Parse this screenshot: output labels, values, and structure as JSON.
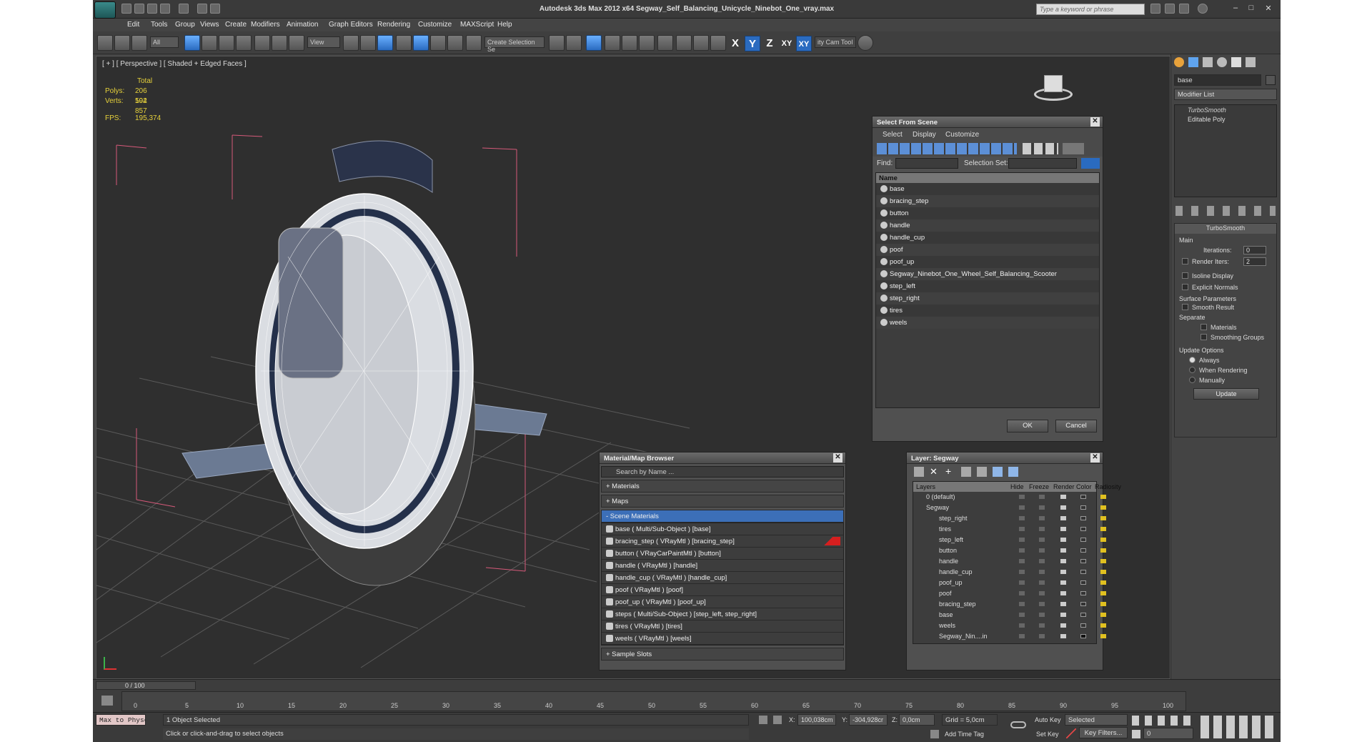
{
  "app": {
    "title": "Autodesk 3ds Max  2012 x64      Segway_Self_Balancing_Unicycle_Ninebot_One_vray.max",
    "search_placeholder": "Type a keyword or phrase"
  },
  "menu": [
    "Edit",
    "Tools",
    "Group",
    "Views",
    "Create",
    "Modifiers",
    "Animation",
    "Graph Editors",
    "Rendering",
    "Customize",
    "MAXScript",
    "Help"
  ],
  "toolbar": {
    "filter_value": "All",
    "view_value": "View",
    "selection_set_placeholder": "Create Selection Se",
    "axes": [
      "X",
      "Y",
      "Z",
      "XY",
      "XY"
    ],
    "cam_tool": "ity Cam Tool"
  },
  "viewport": {
    "label": "[ + ] [ Perspective ] [ Shaded + Edged Faces ]",
    "stats_header": "Total",
    "polys_label": "Polys:",
    "polys_value": "206 592",
    "verts_label": "Verts:",
    "verts_value": "104 857",
    "fps_label": "FPS:",
    "fps_value": "195,374"
  },
  "select_from_scene": {
    "title": "Select From Scene",
    "menu": [
      "Select",
      "Display",
      "Customize"
    ],
    "find_label": "Find:",
    "selection_set_label": "Selection Set:",
    "column_name": "Name",
    "items": [
      "base",
      "bracing_step",
      "button",
      "handle",
      "handle_cup",
      "poof",
      "poof_up",
      "Segway_Ninebot_One_Wheel_Self_Balancing_Scooter",
      "step_left",
      "step_right",
      "tires",
      "weels"
    ],
    "ok": "OK",
    "cancel": "Cancel"
  },
  "material_browser": {
    "title": "Material/Map Browser",
    "search_placeholder": "Search by Name ...",
    "sections": [
      "+ Materials",
      "+ Maps"
    ],
    "scene_materials_header": "- Scene Materials",
    "items": [
      "base  ( Multi/Sub-Object )  [base]",
      "bracing_step  ( VRayMtl )  [bracing_step]",
      "button  ( VRayCarPaintMtl )  [button]",
      "handle  ( VRayMtl )  [handle]",
      "handle_cup  ( VRayMtl )  [handle_cup]",
      "poof  ( VRayMtl )  [poof]",
      "poof_up  ( VRayMtl )  [poof_up]",
      "steps  ( Multi/Sub-Object )  [step_left, step_right]",
      "tires  ( VRayMtl )  [tires]",
      "weels  ( VRayMtl )  [weels]"
    ],
    "sample_slots": "+ Sample Slots"
  },
  "layers": {
    "title": "Layer: Segway",
    "columns": [
      "Layers",
      "Hide",
      "Freeze",
      "Render",
      "Color",
      "Radiosity"
    ],
    "rows": [
      "0 (default)",
      "Segway",
      "step_right",
      "tires",
      "step_left",
      "button",
      "handle",
      "handle_cup",
      "poof_up",
      "poof",
      "bracing_step",
      "base",
      "weels",
      "Segway_Nin....in"
    ]
  },
  "command_panel": {
    "name_value": "base",
    "modifier_list": "Modifier List",
    "stack": [
      "TurboSmooth",
      "Editable Poly"
    ],
    "rollout_title": "TurboSmooth",
    "main_label": "Main",
    "iterations_label": "Iterations:",
    "iterations_value": "0",
    "render_iters_label": "Render Iters:",
    "render_iters_value": "2",
    "isoline": "Isoline Display",
    "explicit_normals": "Explicit Normals",
    "surface_params": "Surface Parameters",
    "smooth_result": "Smooth Result",
    "separate": "Separate",
    "materials": "Materials",
    "smoothing_groups": "Smoothing Groups",
    "update_options": "Update Options",
    "always": "Always",
    "when_rendering": "When Rendering",
    "manually": "Manually",
    "update_button": "Update"
  },
  "timeline": {
    "frame_label": "0 / 100",
    "ticks": [
      "0",
      "5",
      "10",
      "15",
      "20",
      "25",
      "30",
      "35",
      "40",
      "45",
      "50",
      "55",
      "60",
      "65",
      "70",
      "75",
      "80",
      "85",
      "90",
      "95",
      "100"
    ]
  },
  "status": {
    "script_label": "Max to Physc",
    "objects_selected": "1 Object Selected",
    "prompt": "Click or click-and-drag to select objects",
    "x_label": "X:",
    "x_value": "100,038cm",
    "y_label": "Y:",
    "y_value": "-304,928cr",
    "z_label": "Z:",
    "z_value": "0,0cm",
    "grid": "Grid = 5,0cm",
    "add_time_tag": "Add Time Tag",
    "auto_key": "Auto Key",
    "selected": "Selected",
    "set_key": "Set Key",
    "key_filters": "Key Filters...",
    "frame_value": "0"
  }
}
